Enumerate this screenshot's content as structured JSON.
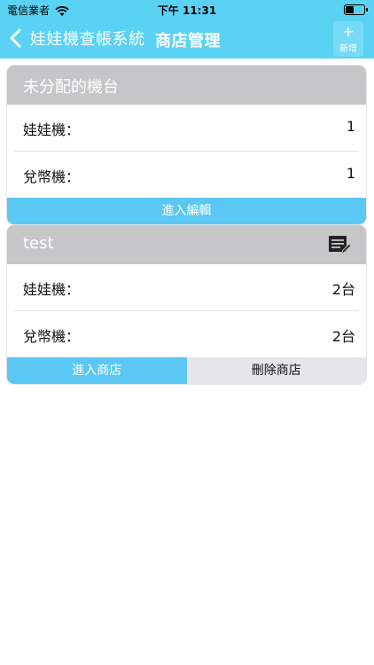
{
  "status": {
    "carrier": "電信業者",
    "time": "下午 11:31"
  },
  "nav": {
    "back_label": "娃娃機查帳系統",
    "title": "商店管理",
    "add_label": "新增",
    "add_symbol": "+"
  },
  "unassigned": {
    "title": "未分配的機台",
    "rows": [
      {
        "label": "娃娃機：",
        "value": "1"
      },
      {
        "label": "兌幣機：",
        "value": "1"
      }
    ],
    "button": "進入編輯"
  },
  "store": {
    "title": "test",
    "rows": [
      {
        "label": "娃娃機：",
        "value": "2台"
      },
      {
        "label": "兌幣機：",
        "value": "2台"
      }
    ],
    "enter_button": "進入商店",
    "delete_button": "刪除商店"
  },
  "colors": {
    "accent": "#5ad2f4",
    "button": "#5ac8f2",
    "header_gray": "#c6c6c9",
    "secondary_btn": "#e5e5ea"
  },
  "icons": [
    "wifi-icon",
    "battery-icon",
    "chevron-left-icon",
    "plus-icon",
    "edit-list-icon"
  ]
}
